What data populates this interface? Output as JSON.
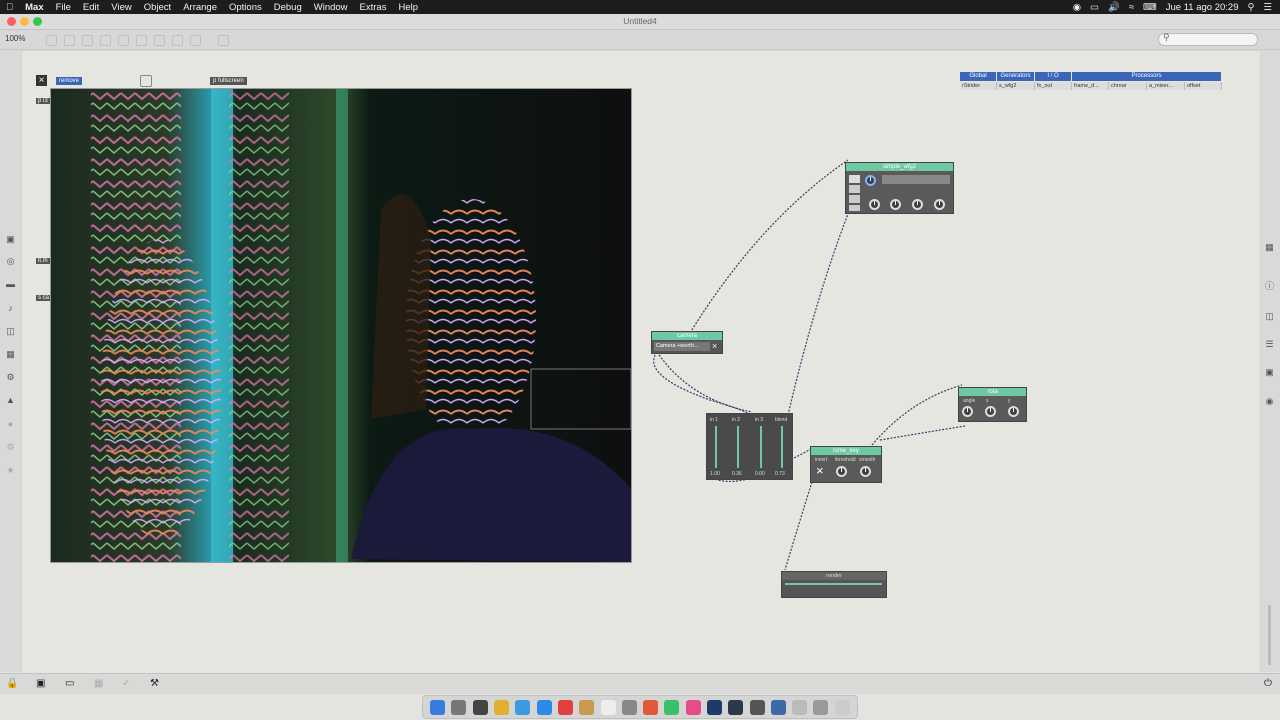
{
  "menubar": {
    "apple": "",
    "app": "Max",
    "items": [
      "File",
      "Edit",
      "View",
      "Object",
      "Arrange",
      "Options",
      "Debug",
      "Window",
      "Extras",
      "Help"
    ],
    "clock": "Jue 11 ago  20:29"
  },
  "window": {
    "title": "Untitled4"
  },
  "toolbar": {
    "zoom": "100%"
  },
  "video_window": {
    "close": "×",
    "btn1": "remove",
    "btn2": "p fullscreen"
  },
  "left_patch": {
    "snippet1": "p i3",
    "snippet2": "lt.m",
    "snippet3": "s ca"
  },
  "tabs": {
    "headers": [
      "Global",
      "Generators",
      "I / O",
      "Processors"
    ],
    "values": [
      "rStrider",
      "s_wfg2",
      "fx_out",
      "frame_d...",
      "chroar",
      "a_mixer...",
      "offset"
    ]
  },
  "objects": {
    "simple_wfg2": {
      "title": "simple_wfg2"
    },
    "camera": {
      "title": "camera",
      "menu": "Camera +worth..."
    },
    "mixer": {
      "labels": [
        "in 1",
        "in 2",
        "in 3",
        "blend"
      ],
      "values": [
        "1.00",
        "0.36",
        "0.00",
        "0.73"
      ]
    },
    "lumaKey": {
      "title": "lume_key",
      "labels": [
        "invert",
        "threshold",
        "smooth"
      ]
    },
    "rota": {
      "title": "rota",
      "labels": [
        "angle",
        "x",
        "y"
      ]
    },
    "render": {
      "title": "render"
    }
  },
  "colors": {
    "accent": "#6dc8a3",
    "tab_blue": "#3b66b8",
    "cable": "#2f3f66"
  }
}
